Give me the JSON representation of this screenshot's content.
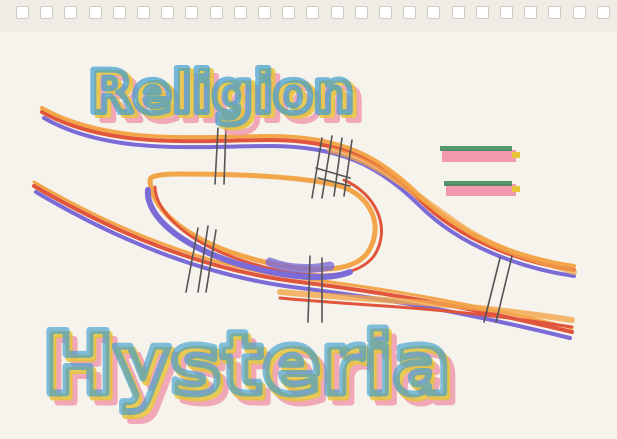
{
  "artwork": {
    "word_top": "Religion",
    "word_bottom": "Hysteria",
    "symbol": "=",
    "marker_colors": [
      "#3f9fd0",
      "#e6c43a",
      "#ef8fa8",
      "#7b6bd6",
      "#f3a54a",
      "#e0553b",
      "#2f7f4e"
    ]
  }
}
